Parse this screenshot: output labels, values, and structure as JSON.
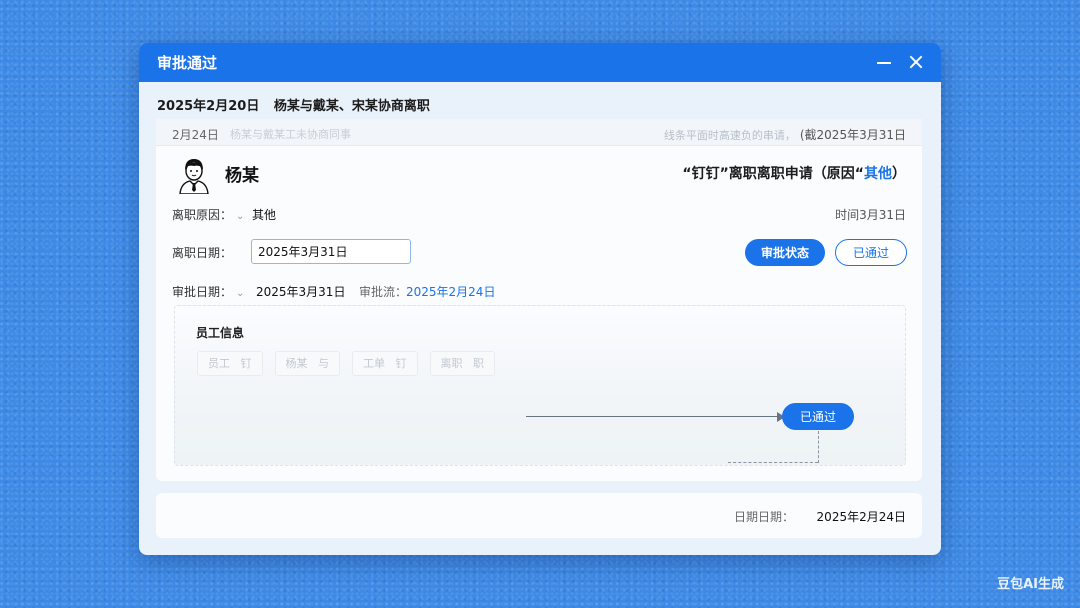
{
  "window": {
    "title": "审批通过",
    "subheader": {
      "date": "2025年2月20日",
      "subject": "杨某与戴某、宋某协商离职"
    }
  },
  "card": {
    "top": {
      "date": "2月24日",
      "faint_note": "杨某与戴某工未协商同事",
      "right_faint": "线条平面时高速负的串请，",
      "right_date": "(截2025年3月31日"
    },
    "applicant": {
      "name": "杨某"
    },
    "application": {
      "prefix": "“钉钉”离职离职申请（原因“",
      "reason": "其他",
      "suffix": "）"
    },
    "fields": {
      "reason_label": "离职原因：",
      "reason_value": "其他",
      "time_label": "时间3月31日",
      "leave_date_label": "离职日期：",
      "leave_date_value": "2025年3月31日",
      "approve_date_label": "审批日期：",
      "approve_date_value": "2025年3月31日",
      "flow_label": "审批流：",
      "flow_value": "2025年2月24日"
    },
    "buttons": {
      "status": "审批状态",
      "approved": "已通过"
    },
    "panel": {
      "title": "员工信息",
      "chips": [
        "员工   钉",
        "杨某   与",
        "工单   钉",
        "离职   职"
      ],
      "flow_button": "已通过"
    }
  },
  "footer": {
    "label": "日期日期：",
    "value": "2025年2月24日"
  },
  "watermark": "豆包AI生成",
  "colors": {
    "accent": "#1a73e8",
    "background": "#3d8ae6"
  },
  "icons": [
    "minimize-icon",
    "close-icon",
    "avatar-icon",
    "chevron-down-icon",
    "arrow-right-icon"
  ]
}
